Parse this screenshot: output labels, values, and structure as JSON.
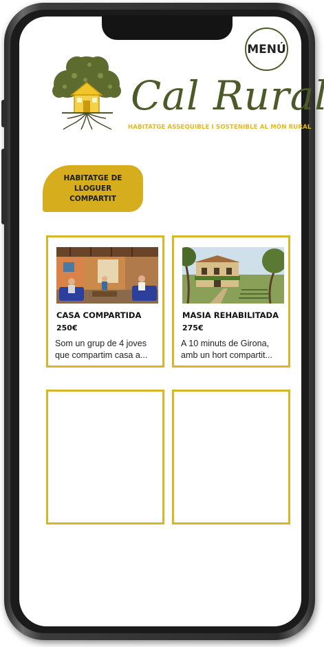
{
  "header": {
    "menu_label": "MENÚ",
    "brand_name": "Cal Rural",
    "tagline": "HABITATGE ASSEQUIBLE I SOSTENIBLE AL MÓN RURAL"
  },
  "category": {
    "label": "HABITATGE DE\nLLOGUER\nCOMPARTIT"
  },
  "listings": [
    {
      "title": "CASA COMPARTIDA",
      "price": "250€",
      "description": "Som un grup de 4 joves que compartim casa a..."
    },
    {
      "title": "MASIA REHABILITADA",
      "price": "275€",
      "description": "A 10 minuts de Girona, amb un hort compartit..."
    }
  ],
  "colors": {
    "accent_gold": "#d8b62a",
    "brand_olive": "#4b5a26",
    "tagline_yellow": "#e3b91f"
  }
}
